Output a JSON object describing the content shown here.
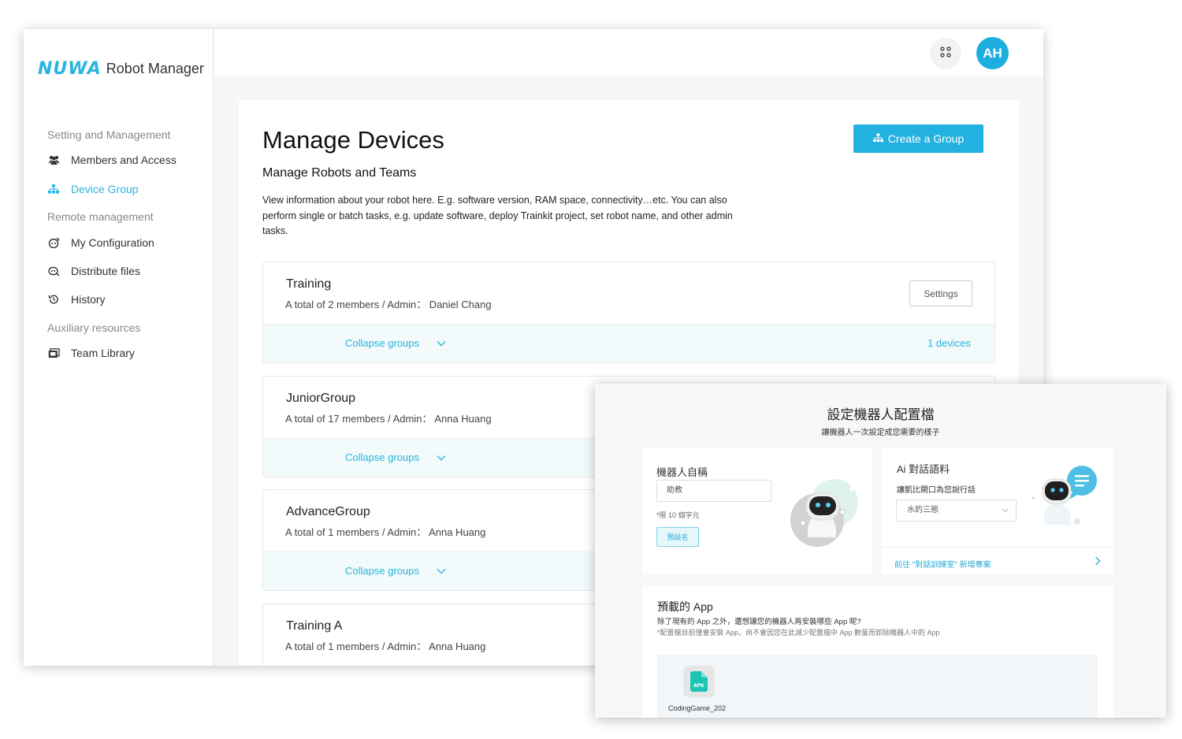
{
  "app": {
    "logo_mark": "NUWA",
    "logo_text": "Robot Manager"
  },
  "sidebar": {
    "sections": {
      "setting": "Setting and Management",
      "remote": "Remote management",
      "aux": "Auxiliary resources"
    },
    "items": [
      {
        "label": "Members and Access",
        "icon": "users-icon"
      },
      {
        "label": "Device Group",
        "icon": "sitemap-icon",
        "active": true
      },
      {
        "label": "My Configuration",
        "icon": "robot-config-icon"
      },
      {
        "label": "Distribute files",
        "icon": "distribute-icon"
      },
      {
        "label": "History",
        "icon": "history-icon"
      },
      {
        "label": "Team Library",
        "icon": "library-icon"
      }
    ]
  },
  "topbar": {
    "avatar_initials": "AH",
    "apps_icon": "grid-dots-icon"
  },
  "main": {
    "title": "Manage Devices",
    "subtitle": "Manage Robots and Teams",
    "description": "View information about your robot here. E.g. software version, RAM space, connectivity…etc. You can also perform single or batch tasks, e.g. update software, deploy Trainkit project, set robot name, and other admin tasks.",
    "create_button": "Create a Group",
    "groups": [
      {
        "name": "Training",
        "meta": "A total of 2 members / Admin： Daniel Chang",
        "settings": "Settings",
        "collapse": "Collapse groups",
        "devices": "1 devices"
      },
      {
        "name": "JuniorGroup",
        "meta": "A total of 17 members / Admin： Anna Huang",
        "collapse": "Collapse groups"
      },
      {
        "name": "AdvanceGroup",
        "meta": "A total of 1 members / Admin： Anna Huang",
        "collapse": "Collapse groups"
      },
      {
        "name": "Training A",
        "meta": "A total of 1 members / Admin： Anna Huang"
      }
    ]
  },
  "overlay": {
    "title": "設定機器人配置檔",
    "subtitle": "讓機器人一次設定成您需要的樣子",
    "name_card": {
      "label": "機器人自稱",
      "input_value": "助教",
      "hint": "*限 10 個字元",
      "default_button": "預設名"
    },
    "ai_card": {
      "label": "Ai 對話語料",
      "desc": "讓凱比開口為您說行話",
      "select_value": "水的三態",
      "link": "前往 \"對話訓練室\" 新增專案"
    },
    "apps": {
      "title": "預載的 App",
      "desc": "除了現有的 App 之外，還想讓您的機器人再安裝哪些 App 呢?",
      "note": "*配置檔目前僅會安裝 App，尚不會因您在此減少配置檔中 App 數量而卸除機器人中的 App",
      "items": [
        {
          "label": "CodingGame_202",
          "badge": "APK"
        }
      ]
    }
  },
  "colors": {
    "accent": "#29b5dc",
    "avatar": "#1daee0",
    "footer_bg": "#f2fafb"
  }
}
